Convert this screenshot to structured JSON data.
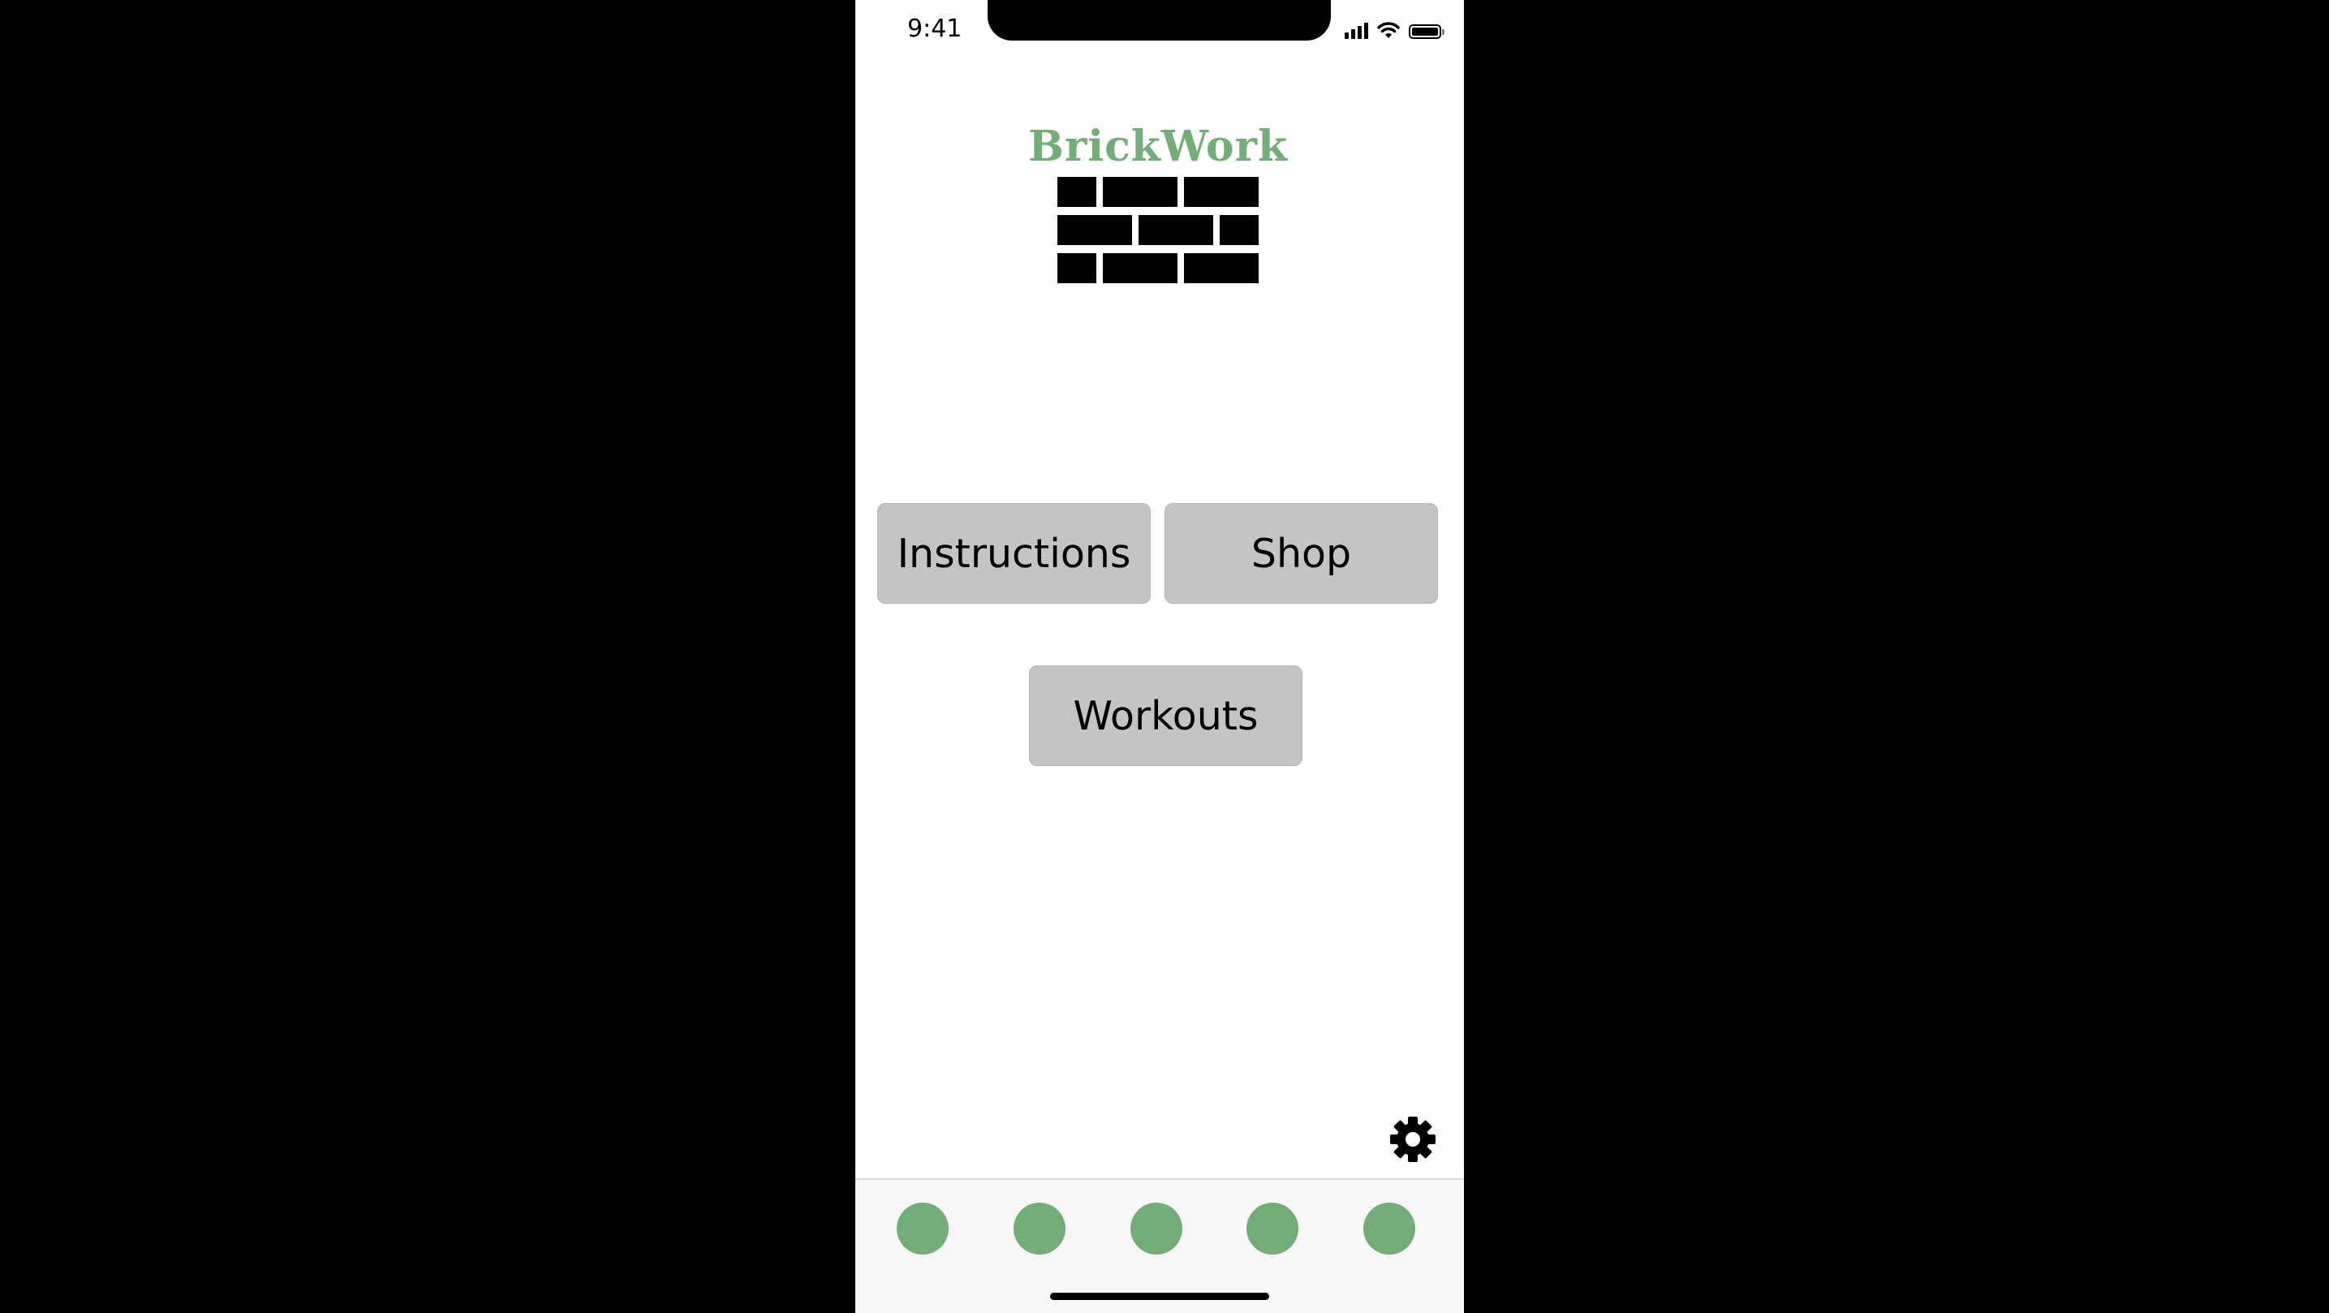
{
  "status_bar": {
    "time": "9:41",
    "icons": [
      "signal-icon",
      "wifi-icon",
      "battery-icon"
    ]
  },
  "app": {
    "name": "BrickWork",
    "logo_color": "#73ad78",
    "logo_icon": "brick-wall-icon"
  },
  "menu": {
    "instructions_label": "Instructions",
    "shop_label": "Shop",
    "workouts_label": "Workouts",
    "button_color": "#c4c4c4"
  },
  "settings": {
    "icon": "gear-icon"
  },
  "tab_bar": {
    "tabs": [
      "tab-1",
      "tab-2",
      "tab-3",
      "tab-4",
      "tab-5"
    ],
    "dot_color": "#73ad78"
  }
}
